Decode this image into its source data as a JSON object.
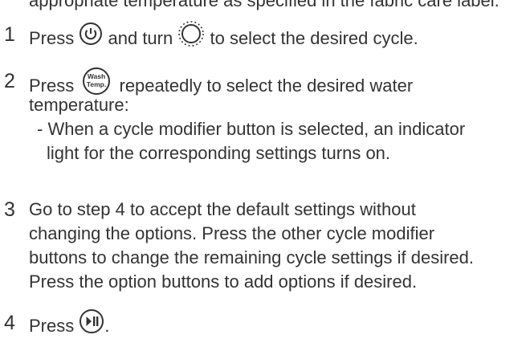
{
  "intro": {
    "text": "appropriate temperature as specified in the fabric care label."
  },
  "steps": [
    {
      "number": "1",
      "segments": [
        "Press",
        "and turn",
        "to select the desired cycle."
      ],
      "icons": [
        "power-button-icon",
        "cycle-dial-icon"
      ]
    },
    {
      "number": "2",
      "line1_start": "Press",
      "line1_end": "repeatedly to select the desired water",
      "line2": "temperature:",
      "button_label_top": "Wash",
      "button_label_bottom": "Temp.",
      "icons": [
        "wash-temp-button-icon"
      ],
      "note_line1": "- When a cycle modifier button is selected, an indicator",
      "note_line2": "light for the corresponding settings turns on."
    },
    {
      "number": "3",
      "lines": [
        "Go to step 4 to accept the default settings without",
        "changing the options. Press the other cycle modifier",
        "buttons to change the remaining cycle settings if desired.",
        "Press the option buttons to add options if desired."
      ]
    },
    {
      "number": "4",
      "text_before": "Press",
      "text_after": ".",
      "icons": [
        "start-pause-button-icon"
      ]
    }
  ]
}
